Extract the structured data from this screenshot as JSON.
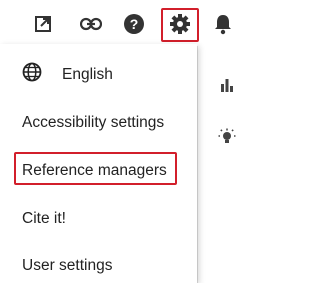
{
  "toolbar": {
    "icons": [
      "open-in-new-icon",
      "link-icon",
      "help-icon",
      "settings-gear-icon",
      "notifications-bell-icon"
    ]
  },
  "settings_menu": {
    "language_label": "English",
    "items": [
      {
        "label": "Accessibility settings"
      },
      {
        "label": "Reference managers"
      },
      {
        "label": "Cite it!"
      },
      {
        "label": "User settings"
      }
    ]
  },
  "right_rail": {
    "icons": [
      "bar-chart-icon",
      "lightbulb-icon"
    ]
  },
  "colors": {
    "highlight": "#d21f2b",
    "icon": "#333333",
    "text": "#222222"
  }
}
